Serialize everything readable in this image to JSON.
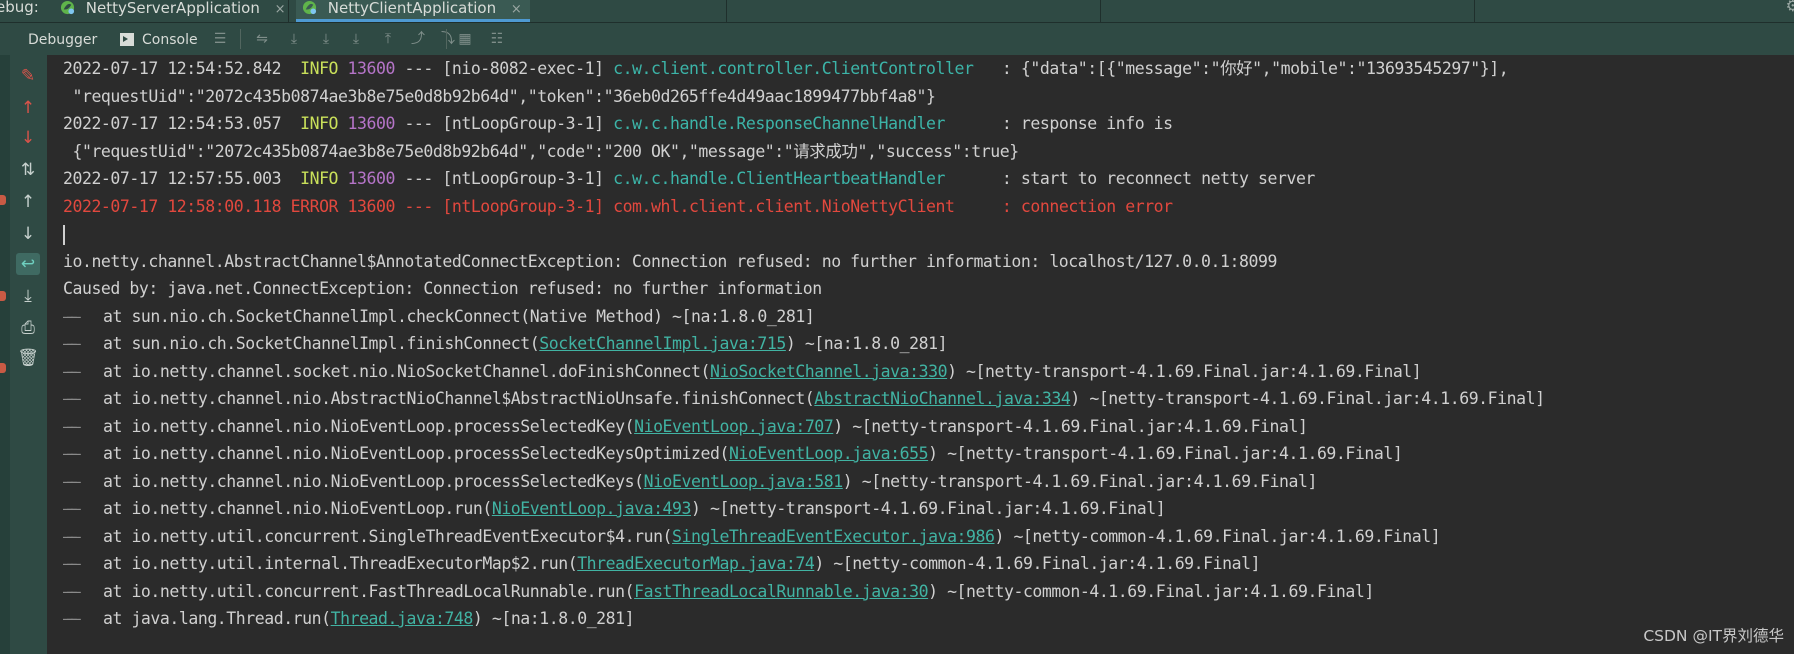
{
  "tabbar": {
    "debug_label": "ebug:",
    "tabs": [
      {
        "label": "NettyServerApplication",
        "close": "×"
      },
      {
        "label": "NettyClientApplication",
        "close": "×"
      }
    ]
  },
  "toolbar": {
    "debugger_label": "Debugger",
    "console_label": "Console"
  },
  "colors": {
    "info": "#c9e05a",
    "pid": "#b574c8",
    "logger": "#3cb4a8",
    "error": "#e2483e",
    "link": "#41b3a3",
    "panel": "#2f4a44",
    "background": "#2b2b2b"
  },
  "log": {
    "entries": [
      {
        "ts": "2022-07-17 12:54:52.842",
        "level": "INFO",
        "pid": "13600",
        "thread": "--- [nio-8082-exec-1]",
        "logger": "c.w.client.controller.ClientController",
        "pad": "   : ",
        "message": "{\"data\":[{\"message\":\"你好\",\"mobile\":\"13693545297\"}],"
      },
      {
        "continuation": " \"requestUid\":\"2072c435b0874ae3b8e75e0d8b92b64d\",\"token\":\"36eb0d265ffe4d49aac1899477bbf4a8\"}"
      },
      {
        "ts": "2022-07-17 12:54:53.057",
        "level": "INFO",
        "pid": "13600",
        "thread": "--- [ntLoopGroup-3-1]",
        "logger": "c.w.c.handle.ResponseChannelHandler",
        "pad": "      : ",
        "message": "response info is"
      },
      {
        "continuation": " {\"requestUid\":\"2072c435b0874ae3b8e75e0d8b92b64d\",\"code\":\"200 OK\",\"message\":\"请求成功\",\"success\":true}"
      },
      {
        "ts": "2022-07-17 12:57:55.003",
        "level": "INFO",
        "pid": "13600",
        "thread": "--- [ntLoopGroup-3-1]",
        "logger": "c.w.c.handle.ClientHeartbeatHandler",
        "pad": "      : ",
        "message": "start to reconnect netty server"
      },
      {
        "ts": "2022-07-17 12:58:00.118",
        "level": "ERROR",
        "pid": "13600",
        "thread": "--- [ntLoopGroup-3-1]",
        "logger": "com.whl.client.client.NioNettyClient",
        "pad": "     : ",
        "message": "connection error"
      }
    ],
    "exception": "io.netty.channel.AbstractChannel$AnnotatedConnectException: Connection refused: no further information: localhost/127.0.0.1:8099",
    "caused_by": "Caused by: java.net.ConnectException: Connection refused: no further information",
    "stack": [
      {
        "method": "at sun.nio.ch.SocketChannelImpl.checkConnect(",
        "link": "",
        "plain": "Native Method",
        "after": ") ~[na:1.8.0_281]"
      },
      {
        "method": "at sun.nio.ch.SocketChannelImpl.finishConnect(",
        "link": "SocketChannelImpl.java:715",
        "plain": "",
        "after": ") ~[na:1.8.0_281]"
      },
      {
        "method": "at io.netty.channel.socket.nio.NioSocketChannel.doFinishConnect(",
        "link": "NioSocketChannel.java:330",
        "plain": "",
        "after": ") ~[netty-transport-4.1.69.Final.jar:4.1.69.Final]"
      },
      {
        "method": "at io.netty.channel.nio.AbstractNioChannel$AbstractNioUnsafe.finishConnect(",
        "link": "AbstractNioChannel.java:334",
        "plain": "",
        "after": ") ~[netty-transport-4.1.69.Final.jar:4.1.69.Final]"
      },
      {
        "method": "at io.netty.channel.nio.NioEventLoop.processSelectedKey(",
        "link": "NioEventLoop.java:707",
        "plain": "",
        "after": ") ~[netty-transport-4.1.69.Final.jar:4.1.69.Final]"
      },
      {
        "method": "at io.netty.channel.nio.NioEventLoop.processSelectedKeysOptimized(",
        "link": "NioEventLoop.java:655",
        "plain": "",
        "after": ") ~[netty-transport-4.1.69.Final.jar:4.1.69.Final]"
      },
      {
        "method": "at io.netty.channel.nio.NioEventLoop.processSelectedKeys(",
        "link": "NioEventLoop.java:581",
        "plain": "",
        "after": ") ~[netty-transport-4.1.69.Final.jar:4.1.69.Final]"
      },
      {
        "method": "at io.netty.channel.nio.NioEventLoop.run(",
        "link": "NioEventLoop.java:493",
        "plain": "",
        "after": ") ~[netty-transport-4.1.69.Final.jar:4.1.69.Final]"
      },
      {
        "method": "at io.netty.util.concurrent.SingleThreadEventExecutor$4.run(",
        "link": "SingleThreadEventExecutor.java:986",
        "plain": "",
        "after": ") ~[netty-common-4.1.69.Final.jar:4.1.69.Final]"
      },
      {
        "method": "at io.netty.util.internal.ThreadExecutorMap$2.run(",
        "link": "ThreadExecutorMap.java:74",
        "plain": "",
        "after": ") ~[netty-common-4.1.69.Final.jar:4.1.69.Final]"
      },
      {
        "method": "at io.netty.util.concurrent.FastThreadLocalRunnable.run(",
        "link": "FastThreadLocalRunnable.java:30",
        "plain": "",
        "after": ") ~[netty-common-4.1.69.Final.jar:4.1.69.Final]"
      },
      {
        "method": "at java.lang.Thread.run(",
        "link": "Thread.java:748",
        "plain": "",
        "after": ") ~[na:1.8.0_281]"
      }
    ]
  },
  "watermark": "CSDN @IT界刘德华"
}
